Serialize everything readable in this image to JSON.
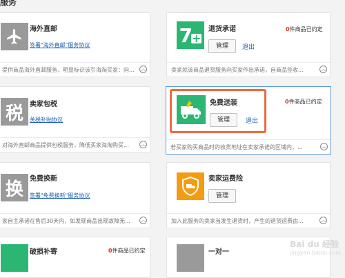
{
  "section_title": "服务",
  "cards": {
    "overseas": {
      "title": "海外直邮",
      "link": "签署\"海外直邮\"服务协议",
      "desc": "提供商品海外直邮服务，明显标识该引海淘买家：向..."
    },
    "return": {
      "badge_count": "0",
      "badge_text": "件商品已约定",
      "title": "退货承诺",
      "manage": "管理",
      "exit": "退出",
      "desc": "卖家就该商品退货服务向买家作出承诺，自商品签收..."
    },
    "tax": {
      "icon_char": "税",
      "title": "卖家包税",
      "link": "关税补贴协议",
      "desc": "对海外直邮商品提供包税服务，降低买家海淘购买..."
    },
    "install": {
      "badge_count": "0",
      "badge_text": "件商品已约定",
      "title": "免费送装",
      "manage": "管理",
      "exit": "退出",
      "desc": "若买家购买商品时的收货地址在卖家承诺的区域内，..."
    },
    "exchange": {
      "icon_char": "换",
      "title": "免费换新",
      "link": "签署\"免费换新\"服务协议",
      "desc": "家自主承诺在售后30天内，如发现商品出现故障无..."
    },
    "freight": {
      "title": "卖家运费险",
      "manage": "管理",
      "desc": "加入此服务的卖家当发生退货时，产生的退货运费由..."
    },
    "damage": {
      "title": "破损补寄",
      "badge_count": "0",
      "badge_text": "件商品已约定"
    },
    "onetoone": {
      "title": "一对一"
    }
  },
  "icons": {
    "overseas": "airplane-icon",
    "return": "seven-plus-icon",
    "install": "truck-wrench-icon",
    "freight": "shield-truck-icon"
  },
  "colors": {
    "gray_icon": "#9a9a9a",
    "green_icon": "#2bb673",
    "orange_icon": "#f39c12",
    "highlight": "#ee6a3c",
    "link": "#1a5fb4",
    "badge_red": "#e0301e"
  },
  "watermark": {
    "line1": "Bai du 经验",
    "line2": "jingyan.baidu.com"
  }
}
